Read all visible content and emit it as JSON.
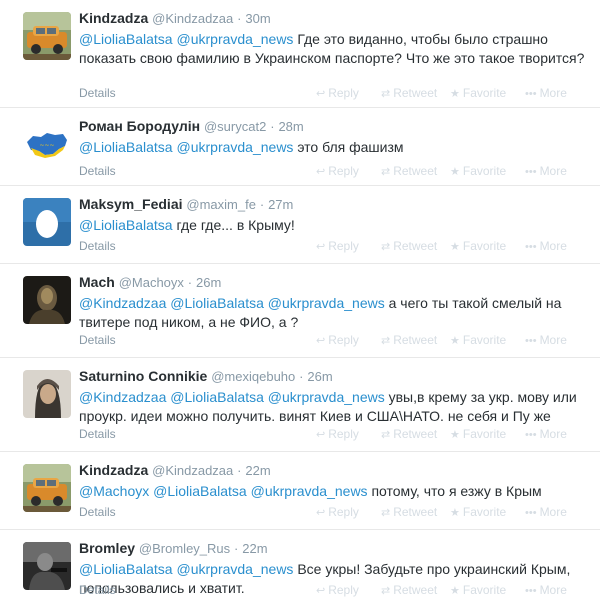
{
  "actions": {
    "details": "Details",
    "reply": "Reply",
    "retweet": "Retweet",
    "favorite": "Favorite",
    "more": "More"
  },
  "tweets": [
    {
      "fullname": "Kindzadza",
      "username": "@Kindzadzaa",
      "time": "30m",
      "mentions": [
        "@LioliaBalatsa",
        "@ukrpravda_news"
      ],
      "text": "Где это виданно, чтобы было страшно показать свою фамилию в Украинском паспорте? Что же это такое творится?",
      "avatar": "car-photo"
    },
    {
      "fullname": "Роман Бородулін",
      "username": "@surycat2",
      "time": "28m",
      "mentions": [
        "@LioliaBalatsa",
        "@ukrpravda_news"
      ],
      "text": "это бля фашизм",
      "avatar": "ukraine-map"
    },
    {
      "fullname": "Maksym_Fediai",
      "username": "@maxim_fe",
      "time": "27m",
      "mentions": [
        "@LioliaBalatsa"
      ],
      "text": "где где... в Крыму!",
      "avatar": "default-egg"
    },
    {
      "fullname": "Mach",
      "username": "@Machoyx",
      "time": "26m",
      "mentions": [
        "@Kindzadzaa",
        "@LioliaBalatsa",
        "@ukrpravda_news"
      ],
      "text": "а чего ты такой смелый на твитере под ником, а не ФИО, а ?",
      "avatar": "dark-figure"
    },
    {
      "fullname": "Saturnino Connikie",
      "username": "@mexiqebuho",
      "time": "26m",
      "mentions": [
        "@Kindzadzaa",
        "@LioliaBalatsa",
        "@ukrpravda_news"
      ],
      "text": "увы,в крему за укр. мову или проукр. идеи можно получить. винят Киев и США\\НАТО. не себя и Пу же",
      "avatar": "portrait"
    },
    {
      "fullname": "Kindzadza",
      "username": "@Kindzadzaa",
      "time": "22m",
      "mentions": [
        "@Machoyx",
        "@LioliaBalatsa",
        "@ukrpravda_news"
      ],
      "text": "потому, что я езжу в Крым",
      "avatar": "car-photo"
    },
    {
      "fullname": "Bromley",
      "username": "@Bromley_Rus",
      "time": "22m",
      "mentions": [
        "@LioliaBalatsa",
        "@ukrpravda_news"
      ],
      "text": "Все укры! Забудьте про украинский Крым, попользовались и хватит.",
      "avatar": "soldier"
    }
  ]
}
